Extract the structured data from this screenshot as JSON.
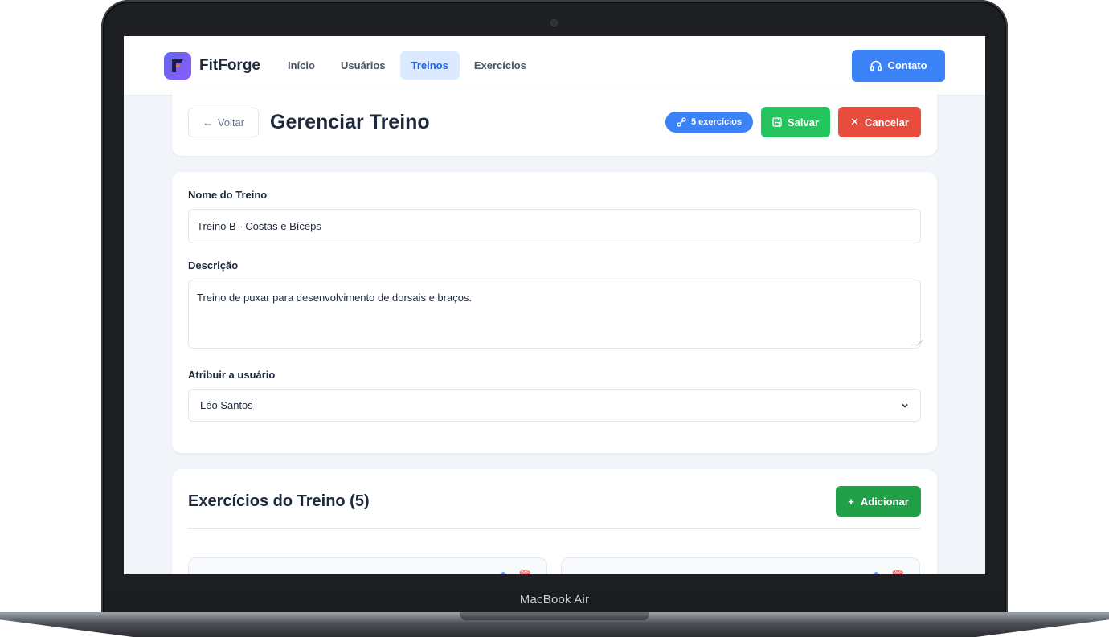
{
  "device": {
    "label": "MacBook Air"
  },
  "navbar": {
    "brand": "FitForge",
    "links": [
      {
        "label": "Início"
      },
      {
        "label": "Usuários"
      },
      {
        "label": "Treinos",
        "active": true
      },
      {
        "label": "Exercícios"
      }
    ],
    "contact_label": "Contato"
  },
  "header": {
    "back_label": "Voltar",
    "title": "Gerenciar Treino",
    "badge_label": "5 exercícios",
    "save_label": "Salvar",
    "cancel_label": "Cancelar"
  },
  "form": {
    "name_label": "Nome do Treino",
    "name_value": "Treino B - Costas e Bíceps",
    "description_label": "Descrição",
    "description_value": "Treino de puxar para desenvolvimento de dorsais e braços.",
    "assign_label": "Atribuir a usuário",
    "assign_value": "Léo Santos"
  },
  "exercises": {
    "title": "Exercícios do Treino (5)",
    "add_label": "Adicionar"
  },
  "colors": {
    "primary": "#3b82f6",
    "success": "#22c55e",
    "danger": "#e74c3c",
    "add": "#22a047"
  }
}
